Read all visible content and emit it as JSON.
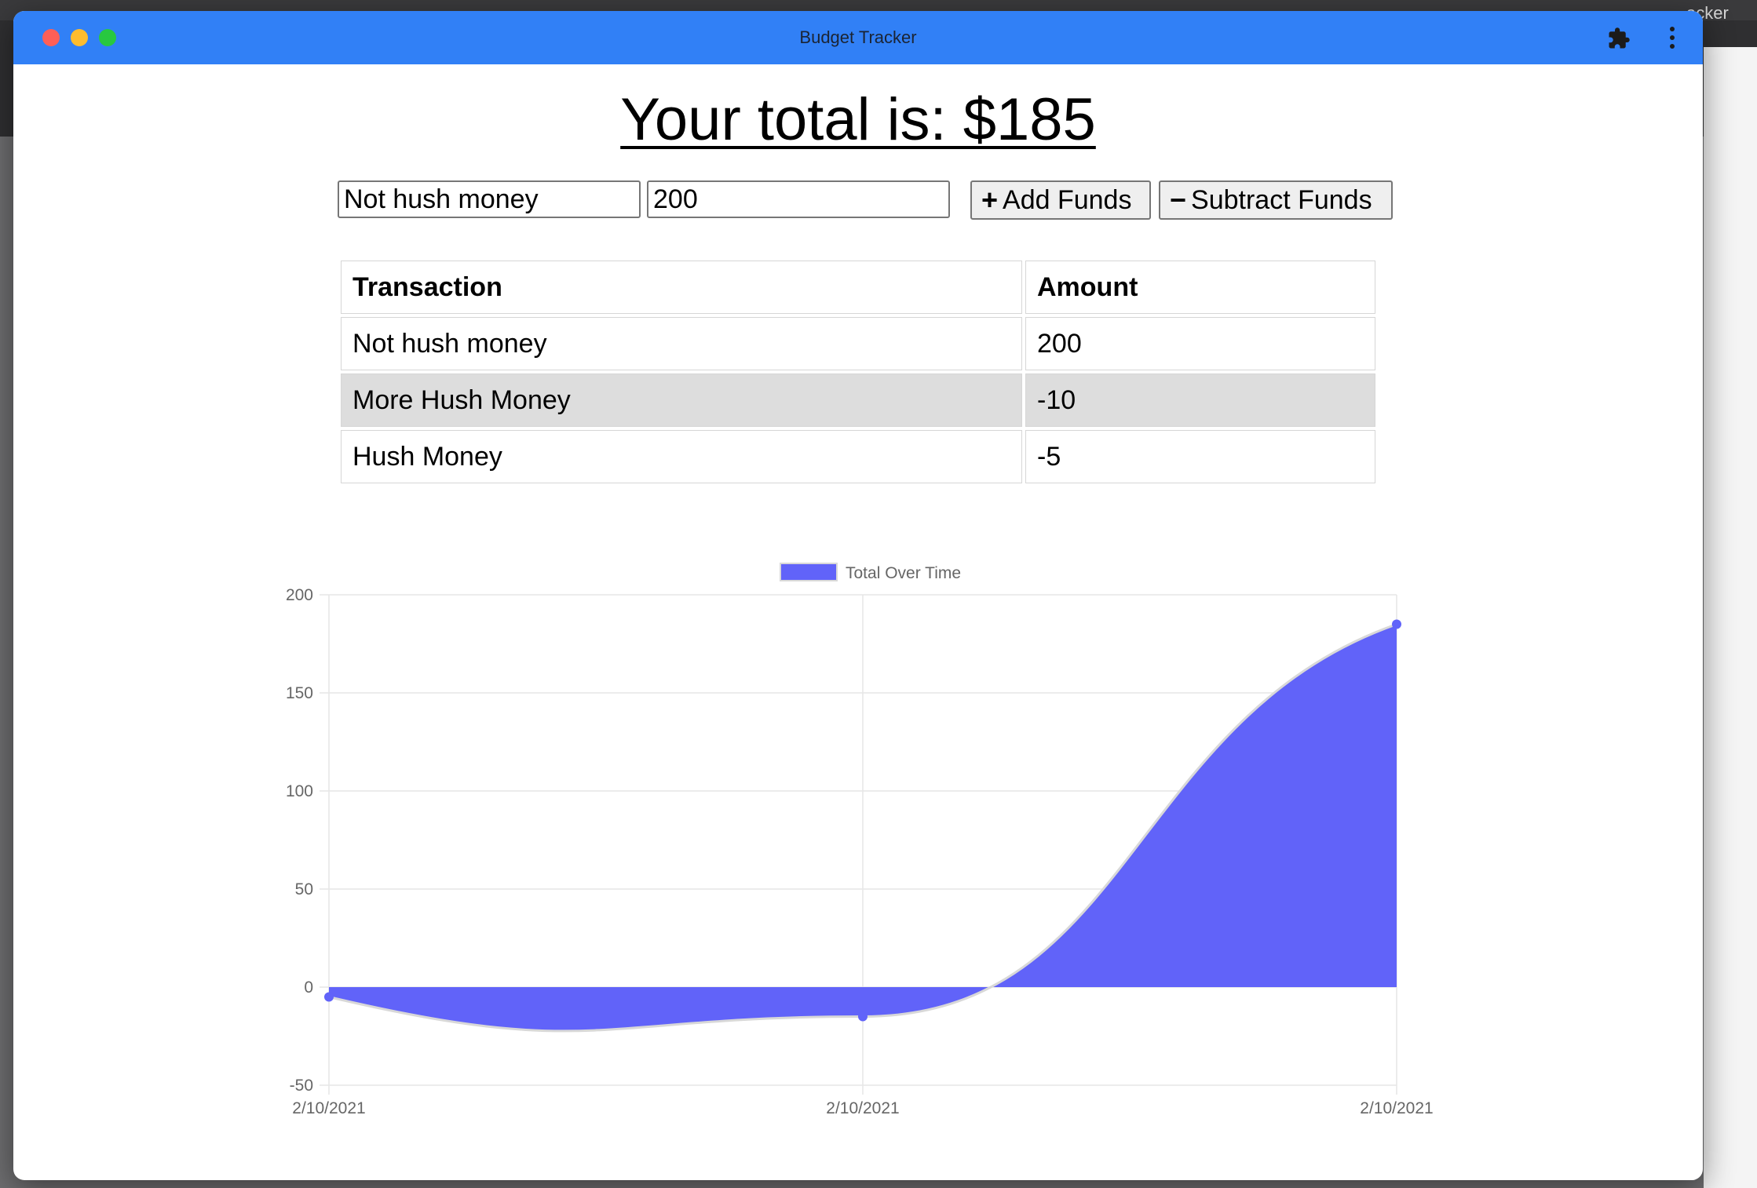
{
  "window": {
    "title": "Budget Tracker"
  },
  "background": {
    "visible_tab_fragment": "acker"
  },
  "header": {
    "total_label": "Your total is: $185"
  },
  "form": {
    "name_value": "Not hush money",
    "amount_value": "200",
    "add_label": "Add Funds",
    "subtract_label": "Subtract Funds"
  },
  "table": {
    "headers": [
      "Transaction",
      "Amount"
    ],
    "rows": [
      {
        "name": "Not hush money",
        "amount": "200"
      },
      {
        "name": "More Hush Money",
        "amount": "-10"
      },
      {
        "name": "Hush Money",
        "amount": "-5"
      }
    ]
  },
  "chart_data": {
    "type": "area",
    "x": [
      "2/10/2021",
      "2/10/2021",
      "2/10/2021"
    ],
    "series": [
      {
        "name": "Total Over Time",
        "values": [
          -5,
          -15,
          185
        ],
        "color": "#6163f9"
      }
    ],
    "ylim": [
      -50,
      200
    ],
    "yticks": [
      200,
      150,
      100,
      50,
      0,
      -50
    ],
    "grid": true,
    "legend": "top-center",
    "title": "",
    "xlabel": "",
    "ylabel": ""
  },
  "colors": {
    "titlebar": "#3180f6",
    "area_fill": "#6163f9",
    "row_highlight": "#dddddd"
  }
}
